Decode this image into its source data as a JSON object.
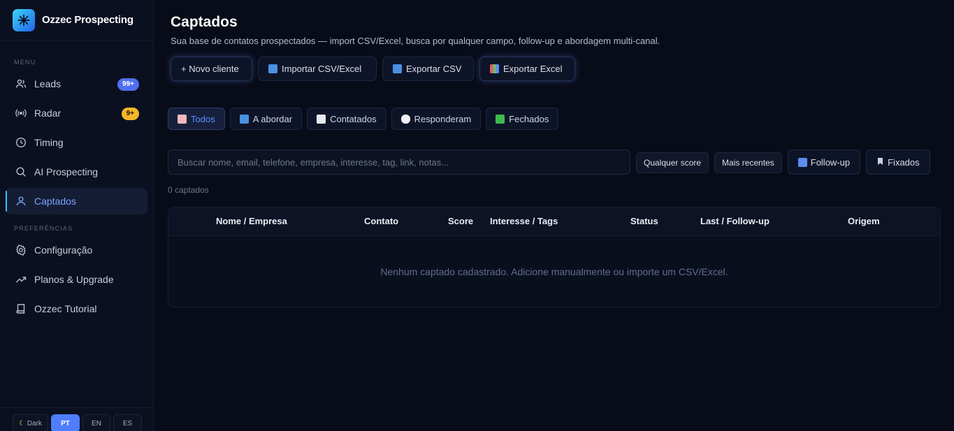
{
  "brand": {
    "name": "Ozzec Prospecting",
    "icon": "snowflake-asterisk-icon"
  },
  "sidebar": {
    "menu_label": "MENU",
    "items": [
      {
        "label": "Leads",
        "icon": "users-icon",
        "badge": "99+"
      },
      {
        "label": "Radar",
        "icon": "radar-waves-icon",
        "badge": "9+"
      },
      {
        "label": "Timing",
        "icon": "clock-icon"
      },
      {
        "label": "AI Prospecting",
        "icon": "search-icon"
      },
      {
        "label": "Captados",
        "icon": "user-icon",
        "active": true
      }
    ],
    "prefs_label": "PREFERÊNCIAS",
    "pref_items": [
      {
        "label": "Configuração",
        "icon": "gear-icon"
      },
      {
        "label": "Planos & Upgrade",
        "icon": "trending-up-icon"
      },
      {
        "label": "Ozzec Tutorial",
        "icon": "book-icon"
      }
    ],
    "footer": {
      "theme": "Dark",
      "languages": [
        "PT",
        "EN",
        "ES"
      ],
      "active_language": "PT"
    }
  },
  "page": {
    "title": "Captados",
    "subtitle": "Sua base de contatos prospectados — import CSV/Excel, busca por qualquer campo, follow-up e abordagem multi-canal."
  },
  "actions": {
    "new_client": "+ Novo cliente",
    "import": "Importar CSV/Excel",
    "export_csv": "Exportar CSV",
    "export_excel": "Exportar Excel"
  },
  "tabs": [
    {
      "label": "Todos",
      "icon": "clipboard-icon",
      "active": true
    },
    {
      "label": "A abordar",
      "icon": "new-badge-icon"
    },
    {
      "label": "Contatados",
      "icon": "envelope-icon"
    },
    {
      "label": "Responderam",
      "icon": "speech-bubble-icon"
    },
    {
      "label": "Fechados",
      "icon": "check-box-icon"
    }
  ],
  "search": {
    "placeholder": "Buscar nome, email, telefone, empresa, interesse, tag, link, notas..."
  },
  "filters": {
    "score": "Qualquer score",
    "sort": "Mais recentes",
    "followup": "Follow-up",
    "pinned": "Fixados"
  },
  "count_text": "0 captados",
  "table": {
    "columns": [
      "Nome / Empresa",
      "Contato",
      "Score",
      "Interesse / Tags",
      "Status",
      "Last / Follow-up",
      "Origem"
    ],
    "empty_text": "Nenhum captado cadastrado. Adicione manualmente ou importe um CSV/Excel."
  },
  "colors": {
    "accent": "#4f7dff",
    "background": "#080c18",
    "sidebar": "#0b1020"
  }
}
